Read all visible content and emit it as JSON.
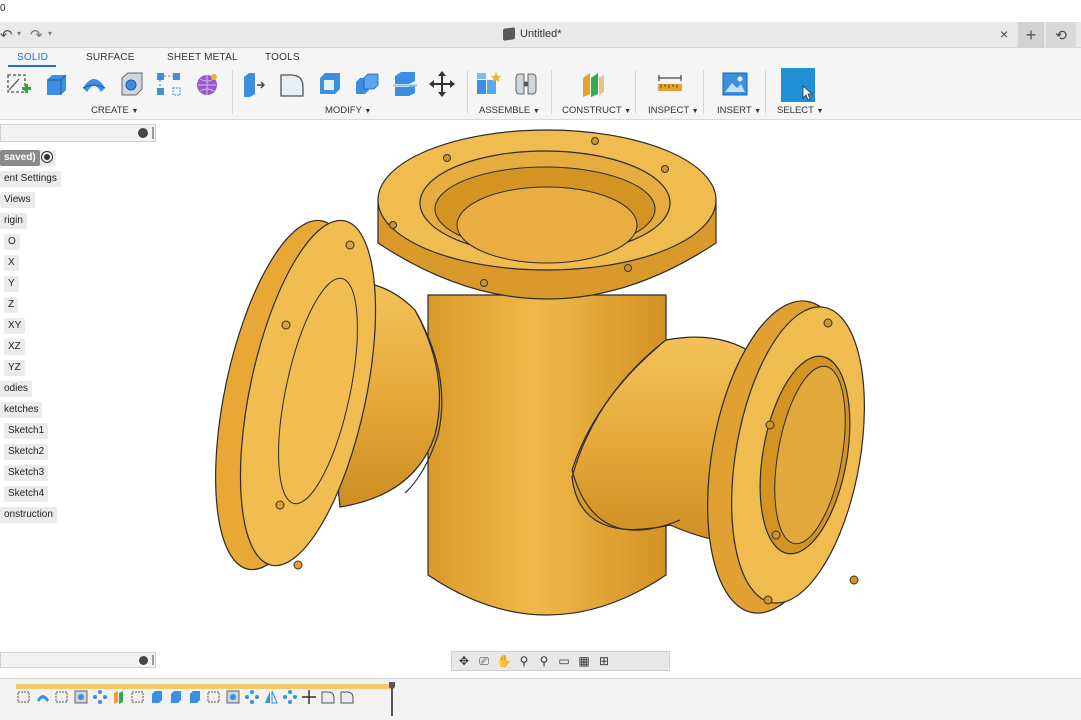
{
  "top_strip": {
    "number": "0"
  },
  "titlebar": {
    "document_title": "Untitled*",
    "close_glyph": "×",
    "new_tab_glyph": "+",
    "history_glyph": "⟲"
  },
  "ribbon": {
    "tabs": [
      {
        "label": "SOLID",
        "active": true
      },
      {
        "label": "SURFACE",
        "active": false
      },
      {
        "label": "SHEET METAL",
        "active": false
      },
      {
        "label": "TOOLS",
        "active": false
      }
    ],
    "groups": {
      "create": "CREATE",
      "modify": "MODIFY",
      "assemble": "ASSEMBLE",
      "construct": "CONSTRUCT",
      "inspect": "INSPECT",
      "insert": "INSERT",
      "select": "SELECT"
    }
  },
  "browser": {
    "items": [
      {
        "label": "saved)"
      },
      {
        "label": "ent Settings"
      },
      {
        "label": "Views"
      },
      {
        "label": "rigin"
      },
      {
        "label": "O"
      },
      {
        "label": "X"
      },
      {
        "label": "Y"
      },
      {
        "label": "Z"
      },
      {
        "label": "XY"
      },
      {
        "label": "XZ"
      },
      {
        "label": "YZ"
      },
      {
        "label": "odies"
      },
      {
        "label": "ketches"
      },
      {
        "label": "Sketch1"
      },
      {
        "label": "Sketch2"
      },
      {
        "label": "Sketch3"
      },
      {
        "label": "Sketch4"
      },
      {
        "label": "onstruction"
      }
    ]
  },
  "colors": {
    "accent": "#1e6fd9",
    "model_fill": "#e8a93a",
    "model_dark": "#c98a22",
    "timeline_bar": "#f2c96e"
  }
}
